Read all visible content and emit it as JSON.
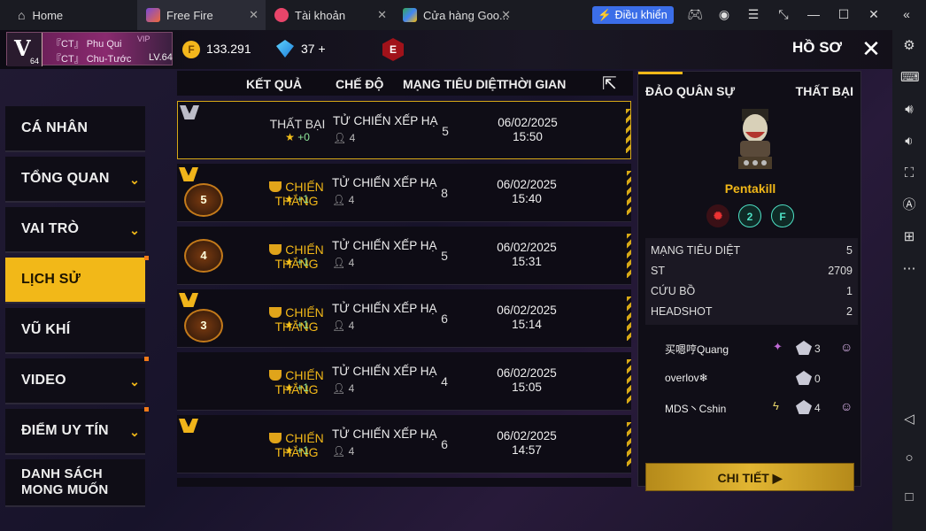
{
  "tabs": {
    "home": "Home",
    "freefire": "Free Fire",
    "account": "Tài khoản",
    "store": "Cửa hàng Goo..."
  },
  "controls": {
    "label": "Điều khiển"
  },
  "profile": {
    "name_line1": "『CT』 Phu Qui",
    "name_line2": "『CT』 Chu-Tước",
    "vip": "VIP",
    "level": "LV.64",
    "avatar_letter": "V",
    "avatar_level": "64"
  },
  "currency": {
    "coins": "133.291",
    "diamonds": "37",
    "plus": "+",
    "e_badge": "E"
  },
  "header": {
    "title": "HỒ SƠ"
  },
  "menu": [
    {
      "label": "CÁ NHÂN"
    },
    {
      "label": "TỔNG QUAN"
    },
    {
      "label": "VAI TRÒ"
    },
    {
      "label": "LỊCH SỬ"
    },
    {
      "label": "VŨ KHÍ"
    },
    {
      "label": "VIDEO"
    },
    {
      "label": "ĐIỂM UY TÍN"
    },
    {
      "label": "DANH SÁCH MONG MUỐN"
    }
  ],
  "table": {
    "headers": {
      "result": "KẾT QUẢ",
      "mode": "CHẾ ĐỘ",
      "kills": "MẠNG TIÊU DIỆT",
      "time": "THỜI GIAN"
    },
    "rows": [
      {
        "result": "THẤT BẠI",
        "stars": "+0",
        "mode": "TỬ CHIẾN XẾP HẠ",
        "players": "4",
        "kills": "5",
        "date": "06/02/2025",
        "time": "15:50"
      },
      {
        "result": "CHIẾN THẮNG",
        "stars": "+1",
        "mode": "TỬ CHIẾN XẾP HẠ",
        "players": "4",
        "kills": "8",
        "date": "06/02/2025",
        "time": "15:40",
        "kill_badge": "5"
      },
      {
        "result": "CHIẾN THẮNG",
        "stars": "+1",
        "mode": "TỬ CHIẾN XẾP HẠ",
        "players": "4",
        "kills": "5",
        "date": "06/02/2025",
        "time": "15:31",
        "kill_badge": "4"
      },
      {
        "result": "CHIẾN THẮNG",
        "stars": "+1",
        "mode": "TỬ CHIẾN XẾP HẠ",
        "players": "4",
        "kills": "6",
        "date": "06/02/2025",
        "time": "15:14",
        "kill_badge": "3"
      },
      {
        "result": "CHIẾN THẮNG",
        "stars": "+1",
        "mode": "TỬ CHIẾN XẾP HẠ",
        "players": "4",
        "kills": "4",
        "date": "06/02/2025",
        "time": "15:05"
      },
      {
        "result": "CHIẾN THẮNG",
        "stars": "+1",
        "mode": "TỬ CHIẾN XẾP HẠ",
        "players": "4",
        "kills": "6",
        "date": "06/02/2025",
        "time": "14:57"
      }
    ]
  },
  "detail": {
    "map": "ĐẢO QUÂN SỰ",
    "result": "THẤT BẠI",
    "title": "Pentakill",
    "medal2": "2",
    "medal3": "F",
    "stats": [
      {
        "label": "MẠNG TIÊU DIỆT",
        "value": "5"
      },
      {
        "label": "ST",
        "value": "2709"
      },
      {
        "label": "CỨU BỒ",
        "value": "1"
      },
      {
        "label": "HEADSHOT",
        "value": "2"
      }
    ],
    "players": [
      {
        "name": "买嗯哼Quang",
        "count": "3"
      },
      {
        "name": "overlov❄",
        "count": "0"
      },
      {
        "name": "MDS丶Cshin",
        "count": "4"
      }
    ],
    "button": "CHI TIẾT ▶"
  },
  "colors": {
    "accent": "#f2b818",
    "tab_active": "#2b2c36",
    "control_blue": "#3b6ee8"
  }
}
